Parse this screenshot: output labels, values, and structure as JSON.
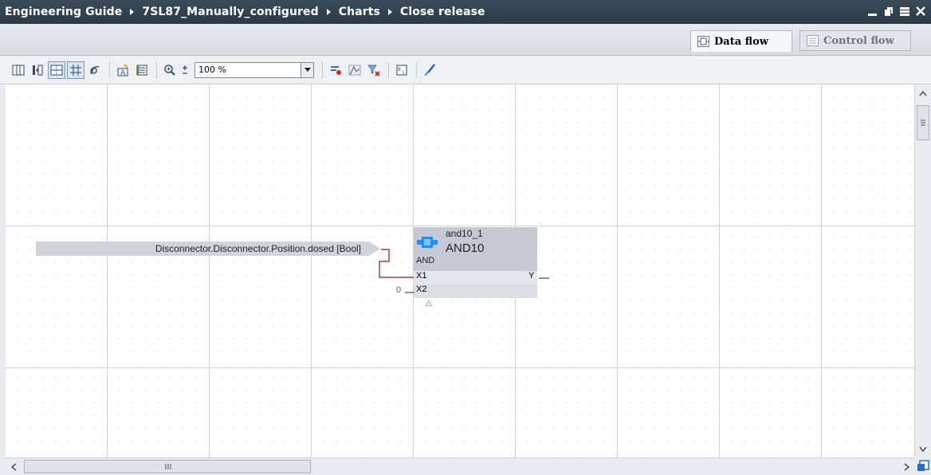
{
  "breadcrumb": [
    "Engineering Guide",
    "7SL87_Manually_configured",
    "Charts",
    "Close release"
  ],
  "window_controls": [
    "minimize-icon",
    "restore-icon",
    "float-icon",
    "close-icon"
  ],
  "view_tabs": [
    {
      "label": "Data flow",
      "active": true,
      "icon": "data-flow-icon"
    },
    {
      "label": "Control flow",
      "active": false,
      "icon": "control-flow-icon"
    }
  ],
  "toolbar": {
    "zoom_value": "100 %",
    "buttons": [
      "column-view-icon",
      "split-view-icon",
      "grid-toggle-icon",
      "grid-lines-icon",
      "routing-icon",
      "comment-icon",
      "list-icon",
      "zoom-in-icon",
      "zoom-options-icon",
      "trace-icon",
      "chart-view-icon",
      "filter-clear-icon",
      "sequence-icon",
      "brush-icon"
    ]
  },
  "chart": {
    "signal_label": "Disconnector.Disconnector.Position.dosed [Bool]",
    "block": {
      "instance": "and10_1",
      "type": "AND10",
      "kind": "AND",
      "inputs": [
        "X1",
        "X2"
      ],
      "output": "Y",
      "x2_constant": "0"
    }
  },
  "colors": {
    "titlebar": "#2f404e",
    "wire": "#8b1a1a",
    "block_icon": "#1e90ff"
  }
}
